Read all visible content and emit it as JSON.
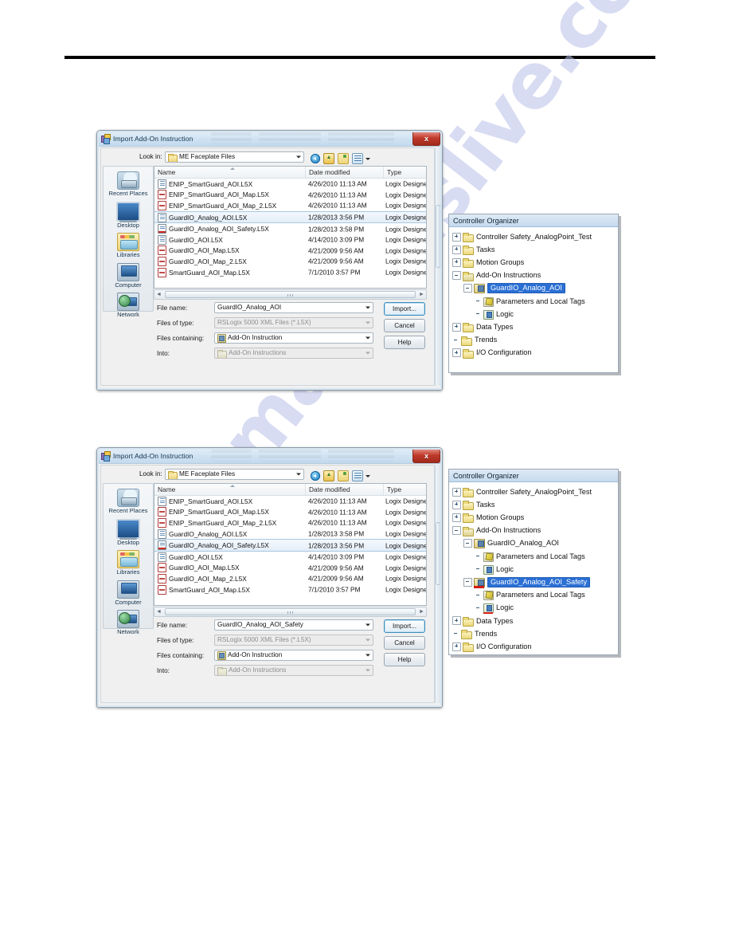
{
  "page": {
    "watermark": "manualslive.com"
  },
  "dialogs": [
    {
      "title": "Import Add-On Instruction",
      "close_label": "x",
      "lookin": {
        "label": "Look in:",
        "value": "ME Faceplate Files"
      },
      "toolbar": {
        "back": "back-icon",
        "up": "up-one-level-icon",
        "new_folder": "new-folder-icon",
        "views": "views-icon"
      },
      "places": [
        {
          "label": "Recent Places",
          "icon": "recent-places-icon"
        },
        {
          "label": "Desktop",
          "icon": "desktop-icon"
        },
        {
          "label": "Libraries",
          "icon": "libraries-icon"
        },
        {
          "label": "Computer",
          "icon": "computer-icon"
        },
        {
          "label": "Network",
          "icon": "network-icon"
        }
      ],
      "columns": [
        "Name",
        "Date modified",
        "Type"
      ],
      "rows": [
        {
          "name": "ENIP_SmartGuard_AOI.L5X",
          "date": "4/26/2010 11:13 AM",
          "type": "Logix Designer X.",
          "icon": "xml",
          "selected": false
        },
        {
          "name": "ENIP_SmartGuard_AOI_Map.L5X",
          "date": "4/26/2010 11:13 AM",
          "type": "Logix Designer X.",
          "icon": "map",
          "selected": false
        },
        {
          "name": "ENIP_SmartGuard_AOI_Map_2.L5X",
          "date": "4/26/2010 11:13 AM",
          "type": "Logix Designer X.",
          "icon": "map",
          "selected": false
        },
        {
          "name": "GuardIO_Analog_AOI.L5X",
          "date": "1/28/2013 3:56 PM",
          "type": "Logix Designer X.",
          "icon": "xml",
          "selected": true
        },
        {
          "name": "GuardIO_Analog_AOI_Safety.L5X",
          "date": "1/28/2013 3:58 PM",
          "type": "Logix Designer X.",
          "icon": "safety",
          "selected": false
        },
        {
          "name": "GuardIO_AOI.L5X",
          "date": "4/14/2010 3:09 PM",
          "type": "Logix Designer X.",
          "icon": "xml",
          "selected": false
        },
        {
          "name": "GuardIO_AOI_Map.L5X",
          "date": "4/21/2009 9:56 AM",
          "type": "Logix Designer X.",
          "icon": "map",
          "selected": false
        },
        {
          "name": "GuardIO_AOI_Map_2.L5X",
          "date": "4/21/2009 9:56 AM",
          "type": "Logix Designer X.",
          "icon": "map",
          "selected": false
        },
        {
          "name": "SmartGuard_AOI_Map.L5X",
          "date": "7/1/2010 3:57 PM",
          "type": "Logix Designer X.",
          "icon": "map",
          "selected": false
        }
      ],
      "fields": {
        "filename_label": "File name:",
        "filename_value": "GuardIO_Analog_AOI",
        "filetype_label": "Files of type:",
        "filetype_value": "RSLogix 5000 XML Files (*.L5X)",
        "containing_label": "Files containing:",
        "containing_value": "Add-On Instruction",
        "into_label": "Into:",
        "into_value": "Add-On Instructions"
      },
      "buttons": {
        "import": "Import...",
        "cancel": "Cancel",
        "help": "Help"
      }
    },
    {
      "title": "Import Add-On Instruction",
      "close_label": "x",
      "lookin": {
        "label": "Look in:",
        "value": "ME Faceplate Files"
      },
      "toolbar": {
        "back": "back-icon",
        "up": "up-one-level-icon",
        "new_folder": "new-folder-icon",
        "views": "views-icon"
      },
      "places": [
        {
          "label": "Recent Places",
          "icon": "recent-places-icon"
        },
        {
          "label": "Desktop",
          "icon": "desktop-icon"
        },
        {
          "label": "Libraries",
          "icon": "libraries-icon"
        },
        {
          "label": "Computer",
          "icon": "computer-icon"
        },
        {
          "label": "Network",
          "icon": "network-icon"
        }
      ],
      "columns": [
        "Name",
        "Date modified",
        "Type"
      ],
      "rows": [
        {
          "name": "ENIP_SmartGuard_AOI.L5X",
          "date": "4/26/2010 11:13 AM",
          "type": "Logix Designer X.",
          "icon": "xml",
          "selected": false
        },
        {
          "name": "ENIP_SmartGuard_AOI_Map.L5X",
          "date": "4/26/2010 11:13 AM",
          "type": "Logix Designer X.",
          "icon": "map",
          "selected": false
        },
        {
          "name": "ENIP_SmartGuard_AOI_Map_2.L5X",
          "date": "4/26/2010 11:13 AM",
          "type": "Logix Designer X.",
          "icon": "map",
          "selected": false
        },
        {
          "name": "GuardIO_Analog_AOI.L5X",
          "date": "1/28/2013 3:58 PM",
          "type": "Logix Designer X.",
          "icon": "xml",
          "selected": false
        },
        {
          "name": "GuardIO_Analog_AOI_Safety.L5X",
          "date": "1/28/2013 3:56 PM",
          "type": "Logix Designer X.",
          "icon": "safety",
          "selected": true
        },
        {
          "name": "GuardIO_AOI.L5X",
          "date": "4/14/2010 3:09 PM",
          "type": "Logix Designer X.",
          "icon": "xml",
          "selected": false
        },
        {
          "name": "GuardIO_AOI_Map.L5X",
          "date": "4/21/2009 9:56 AM",
          "type": "Logix Designer X.",
          "icon": "map",
          "selected": false
        },
        {
          "name": "GuardIO_AOI_Map_2.L5X",
          "date": "4/21/2009 9:56 AM",
          "type": "Logix Designer X.",
          "icon": "map",
          "selected": false
        },
        {
          "name": "SmartGuard_AOI_Map.L5X",
          "date": "7/1/2010 3:57 PM",
          "type": "Logix Designer X.",
          "icon": "map",
          "selected": false
        }
      ],
      "fields": {
        "filename_label": "File name:",
        "filename_value": "GuardIO_Analog_AOI_Safety",
        "filetype_label": "Files of type:",
        "filetype_value": "RSLogix 5000 XML Files (*.L5X)",
        "containing_label": "Files containing:",
        "containing_value": "Add-On Instruction",
        "into_label": "Into:",
        "into_value": "Add-On Instructions"
      },
      "buttons": {
        "import": "Import...",
        "cancel": "Cancel",
        "help": "Help"
      }
    }
  ],
  "organizers": [
    {
      "title": "Controller Organizer",
      "nodes": [
        {
          "label": "Controller Safety_AnalogPoint_Test",
          "indent": 0,
          "icon": "folder",
          "expander": "plus",
          "selected": false
        },
        {
          "label": "Tasks",
          "indent": 0,
          "icon": "folder",
          "expander": "plus",
          "selected": false
        },
        {
          "label": "Motion Groups",
          "indent": 0,
          "icon": "folder",
          "expander": "plus",
          "selected": false
        },
        {
          "label": "Add-On Instructions",
          "indent": 0,
          "icon": "folder-open",
          "expander": "minus",
          "selected": false
        },
        {
          "label": "GuardIO_Analog_AOI",
          "indent": 1,
          "icon": "aoi",
          "expander": "minus",
          "selected": true
        },
        {
          "label": "Parameters and Local Tags",
          "indent": 2,
          "icon": "param",
          "expander": "none",
          "selected": false
        },
        {
          "label": "Logic",
          "indent": 2,
          "icon": "logic",
          "expander": "none",
          "selected": false
        },
        {
          "label": "Data Types",
          "indent": 0,
          "icon": "folder",
          "expander": "plus",
          "selected": false
        },
        {
          "label": "Trends",
          "indent": 0,
          "icon": "folder",
          "expander": "none",
          "selected": false
        },
        {
          "label": "I/O Configuration",
          "indent": 0,
          "icon": "folder",
          "expander": "plus",
          "selected": false
        }
      ]
    },
    {
      "title": "Controller Organizer",
      "nodes": [
        {
          "label": "Controller Safety_AnalogPoint_Test",
          "indent": 0,
          "icon": "folder",
          "expander": "plus",
          "selected": false
        },
        {
          "label": "Tasks",
          "indent": 0,
          "icon": "folder",
          "expander": "plus",
          "selected": false
        },
        {
          "label": "Motion Groups",
          "indent": 0,
          "icon": "folder",
          "expander": "plus",
          "selected": false
        },
        {
          "label": "Add-On Instructions",
          "indent": 0,
          "icon": "folder-open",
          "expander": "minus",
          "selected": false
        },
        {
          "label": "GuardIO_Analog_AOI",
          "indent": 1,
          "icon": "aoi",
          "expander": "minus",
          "selected": false
        },
        {
          "label": "Parameters and Local Tags",
          "indent": 2,
          "icon": "param",
          "expander": "none",
          "selected": false
        },
        {
          "label": "Logic",
          "indent": 2,
          "icon": "logic",
          "expander": "none",
          "selected": false
        },
        {
          "label": "GuardIO_Analog_AOI_Safety",
          "indent": 1,
          "icon": "aoi-safety",
          "expander": "minus",
          "selected": true
        },
        {
          "label": "Parameters and Local Tags",
          "indent": 2,
          "icon": "param",
          "expander": "none",
          "selected": false
        },
        {
          "label": "Logic",
          "indent": 2,
          "icon": "logic-safety",
          "expander": "none",
          "selected": false
        },
        {
          "label": "Data Types",
          "indent": 0,
          "icon": "folder",
          "expander": "plus",
          "selected": false
        },
        {
          "label": "Trends",
          "indent": 0,
          "icon": "folder",
          "expander": "none",
          "selected": false
        },
        {
          "label": "I/O Configuration",
          "indent": 0,
          "icon": "folder",
          "expander": "plus",
          "selected": false
        }
      ]
    }
  ]
}
